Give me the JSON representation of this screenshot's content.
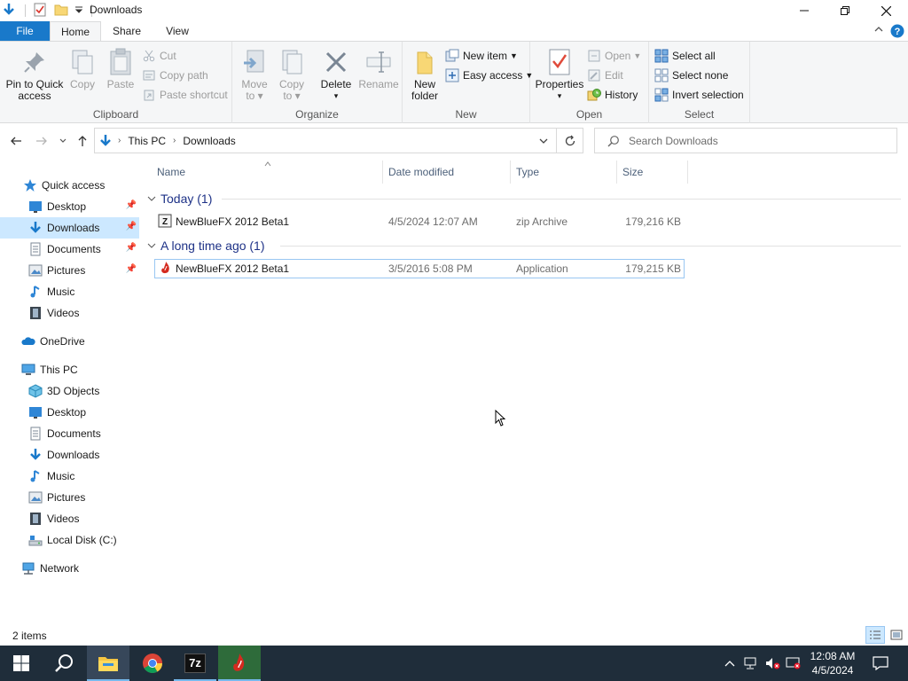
{
  "window": {
    "title": "Downloads"
  },
  "tabs": {
    "file": "File",
    "home": "Home",
    "share": "Share",
    "view": "View"
  },
  "ribbon": {
    "clipboard": {
      "label": "Clipboard",
      "pin_line1": "Pin to Quick",
      "pin_line2": "access",
      "copy": "Copy",
      "paste": "Paste",
      "cut": "Cut",
      "copy_path": "Copy path",
      "paste_shortcut": "Paste shortcut"
    },
    "organize": {
      "label": "Organize",
      "move_to_line1": "Move",
      "move_to_line2": "to",
      "copy_to_line1": "Copy",
      "copy_to_line2": "to",
      "delete": "Delete",
      "rename": "Rename"
    },
    "new": {
      "label": "New",
      "new_folder_line1": "New",
      "new_folder_line2": "folder",
      "new_item": "New item",
      "easy_access": "Easy access"
    },
    "open": {
      "label": "Open",
      "properties": "Properties",
      "open": "Open",
      "edit": "Edit",
      "history": "History"
    },
    "select": {
      "label": "Select",
      "select_all": "Select all",
      "select_none": "Select none",
      "invert_selection": "Invert selection"
    }
  },
  "address": {
    "crumbs": [
      "This PC",
      "Downloads"
    ],
    "search_placeholder": "Search Downloads"
  },
  "sidebar": {
    "items": [
      {
        "label": "Quick access",
        "icon": "star-icon",
        "pinned": false
      },
      {
        "label": "Desktop",
        "icon": "desktop-folder-icon",
        "pinned": true
      },
      {
        "label": "Downloads",
        "icon": "downloads-folder-icon",
        "pinned": true,
        "selected": true
      },
      {
        "label": "Documents",
        "icon": "documents-folder-icon",
        "pinned": true
      },
      {
        "label": "Pictures",
        "icon": "pictures-folder-icon",
        "pinned": true
      },
      {
        "label": "Music",
        "icon": "music-folder-icon",
        "pinned": false
      },
      {
        "label": "Videos",
        "icon": "videos-folder-icon",
        "pinned": false
      },
      {
        "label": "OneDrive",
        "icon": "onedrive-cloud-icon",
        "pinned": false
      },
      {
        "label": "This PC",
        "icon": "this-pc-icon",
        "pinned": false
      },
      {
        "label": "3D Objects",
        "icon": "3d-objects-folder-icon",
        "pinned": false
      },
      {
        "label": "Desktop",
        "icon": "desktop-folder-icon",
        "pinned": false
      },
      {
        "label": "Documents",
        "icon": "documents-folder-icon",
        "pinned": false
      },
      {
        "label": "Downloads",
        "icon": "downloads-folder-icon",
        "pinned": false
      },
      {
        "label": "Music",
        "icon": "music-folder-icon",
        "pinned": false
      },
      {
        "label": "Pictures",
        "icon": "pictures-folder-icon",
        "pinned": false
      },
      {
        "label": "Videos",
        "icon": "videos-folder-icon",
        "pinned": false
      },
      {
        "label": "Local Disk (C:)",
        "icon": "local-disk-icon",
        "pinned": false
      },
      {
        "label": "Network",
        "icon": "network-icon",
        "pinned": false
      }
    ]
  },
  "columns": {
    "name": "Name",
    "date": "Date modified",
    "type": "Type",
    "size": "Size"
  },
  "groups": [
    {
      "header": "Today (1)",
      "files": [
        {
          "name": "NewBlueFX 2012 Beta1",
          "date": "4/5/2024 12:07 AM",
          "type": "zip Archive",
          "size": "179,216 KB",
          "icon": "zip-archive-icon"
        }
      ]
    },
    {
      "header": "A long time ago (1)",
      "files": [
        {
          "name": "NewBlueFX 2012 Beta1",
          "date": "3/5/2016 5:08 PM",
          "type": "Application",
          "size": "179,215 KB",
          "icon": "application-icon"
        }
      ]
    }
  ],
  "status": {
    "items": "2 items"
  },
  "taskbar": {
    "time": "12:08 AM",
    "date": "4/5/2024",
    "sevenzip_label": "7z"
  },
  "colors": {
    "accent": "#1979ca",
    "selection": "#cce8ff",
    "group_header": "#1e3287",
    "taskbar": "#1f2d3a"
  }
}
